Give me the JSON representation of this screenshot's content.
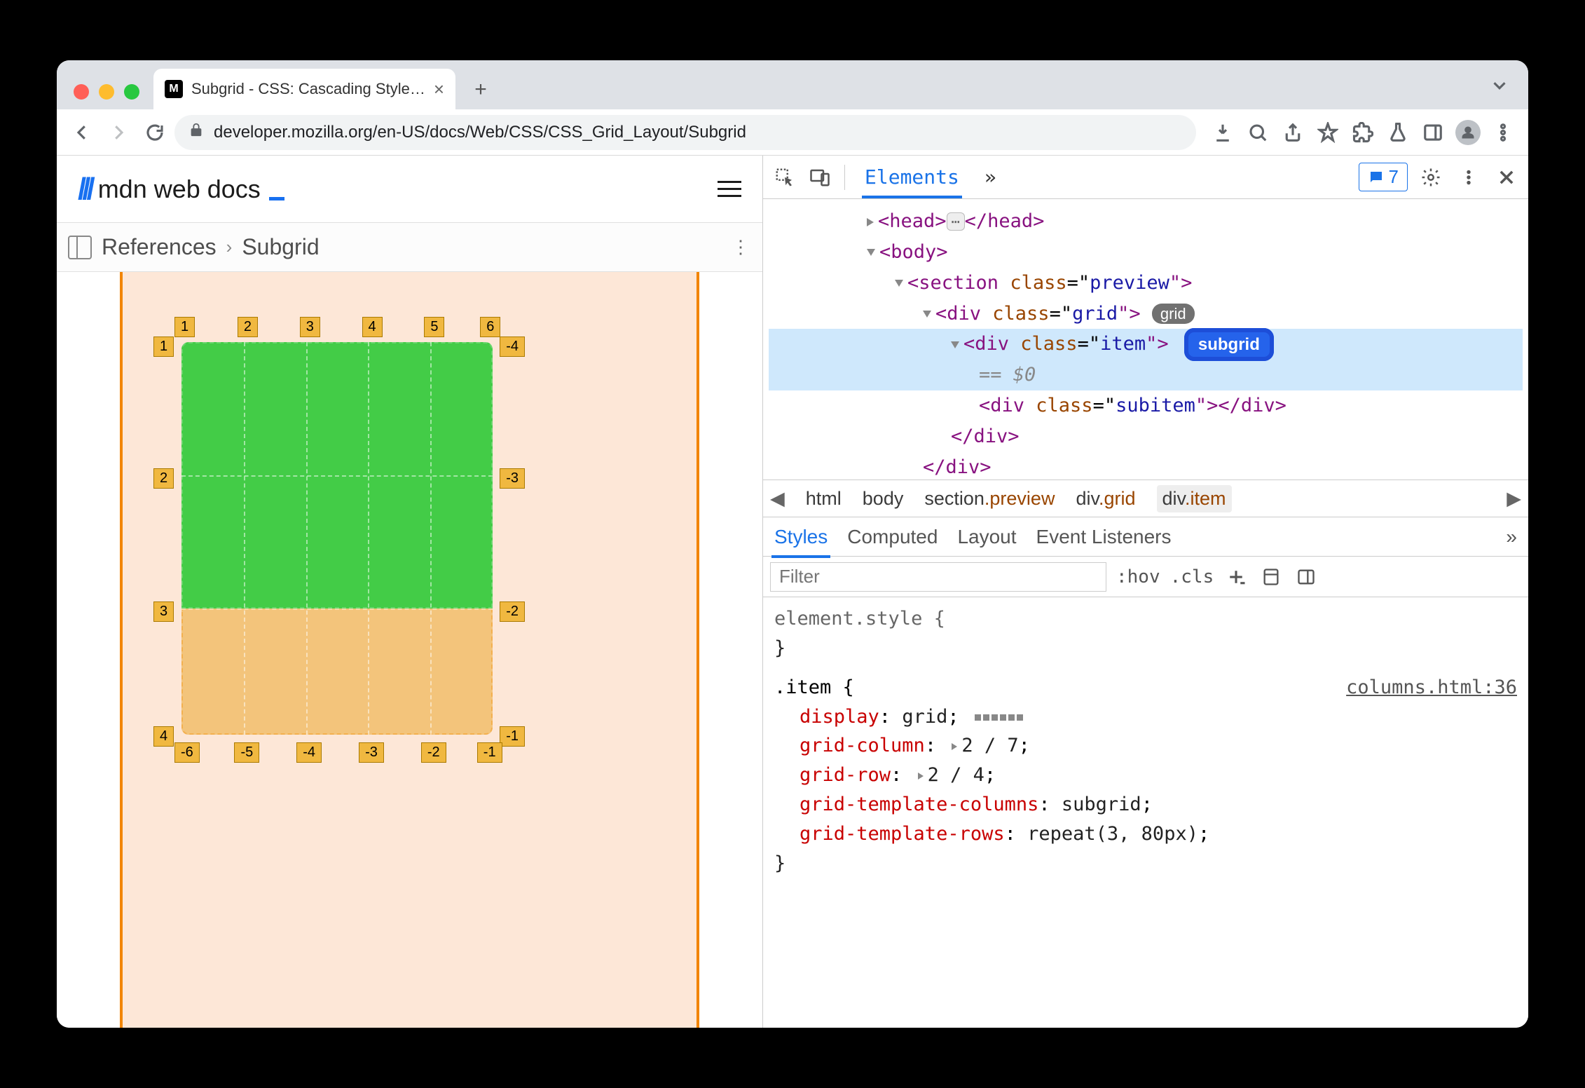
{
  "browser": {
    "tabTitle": "Subgrid - CSS: Cascading Style…",
    "url": "developer.mozilla.org/en-US/docs/Web/CSS/CSS_Grid_Layout/Subgrid"
  },
  "mdn": {
    "logoText": "mdn web docs",
    "breadcrumb": {
      "root": "References",
      "current": "Subgrid"
    },
    "grid": {
      "topLabels": [
        "1",
        "2",
        "3",
        "4",
        "5",
        "6"
      ],
      "leftLabels": [
        "1",
        "2",
        "3",
        "4"
      ],
      "rightLabels": [
        "-4",
        "-3",
        "-2",
        "-1"
      ],
      "bottomLabels": [
        "-6",
        "-5",
        "-4",
        "-3",
        "-2",
        "-1"
      ]
    }
  },
  "devtools": {
    "panel": "Elements",
    "moreGlyph": "»",
    "issuesCount": "7",
    "dom": {
      "headOpen": "<head>",
      "headClose": "</head>",
      "bodyOpen": "<body>",
      "sectionOpen": "<section class=\"preview\">",
      "gridOpen": "<div class=\"grid\">",
      "gridBadge": "grid",
      "itemOpen": "<div class=\"item\">",
      "subgridBadge": "subgrid",
      "eqVar": "== $0",
      "subitem": "<div class=\"subitem\"></div>",
      "divClose": "</div>",
      "divClose2": "</div>"
    },
    "crumbs": [
      "html",
      "body",
      "section.preview",
      "div.grid",
      "div.item"
    ],
    "subtabs": [
      "Styles",
      "Computed",
      "Layout",
      "Event Listeners"
    ],
    "filter": {
      "placeholder": "Filter",
      "hov": ":hov",
      "cls": ".cls"
    },
    "styles": {
      "elementStyle": "element.style {",
      "closeBrace": "}",
      "rule": {
        "selector": ".item {",
        "sourceLink": "columns.html:36",
        "props": [
          {
            "k": "display",
            "v": "grid",
            "chip": true
          },
          {
            "k": "grid-column",
            "v": "2 / 7",
            "tri": true
          },
          {
            "k": "grid-row",
            "v": "2 / 4",
            "tri": true
          },
          {
            "k": "grid-template-columns",
            "v": "subgrid"
          },
          {
            "k": "grid-template-rows",
            "v": "repeat(3, 80px)"
          }
        ]
      }
    }
  }
}
